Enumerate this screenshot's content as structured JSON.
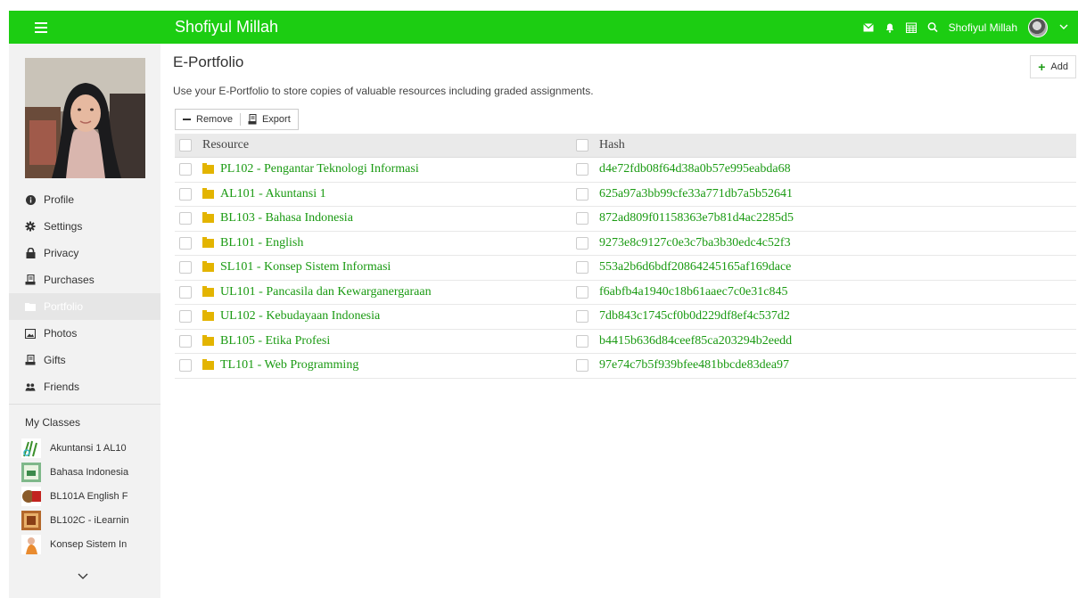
{
  "topbar": {
    "title": "Shofiyul Millah",
    "user_name": "Shofiyul Millah"
  },
  "sidebar": {
    "nav": [
      {
        "label": "Profile",
        "icon": "info-circle-icon"
      },
      {
        "label": "Settings",
        "icon": "gear-icon"
      },
      {
        "label": "Privacy",
        "icon": "lock-icon"
      },
      {
        "label": "Purchases",
        "icon": "receipt-icon"
      },
      {
        "label": "Portfolio",
        "icon": "folder-icon",
        "active": true
      },
      {
        "label": "Photos",
        "icon": "image-icon"
      },
      {
        "label": "Gifts",
        "icon": "gift-icon"
      },
      {
        "label": "Friends",
        "icon": "users-icon"
      }
    ],
    "classes_title": "My Classes",
    "classes": [
      "Akuntansi 1 AL10",
      "Bahasa Indonesia",
      "BL101A English F",
      "BL102C - iLearnin",
      "Konsep Sistem In"
    ]
  },
  "main": {
    "title": "E-Portfolio",
    "add_label": "Add",
    "description": "Use your E-Portfolio to store copies of valuable resources including graded assignments.",
    "remove_label": "Remove",
    "export_label": "Export",
    "columns": {
      "resource": "Resource",
      "hash": "Hash"
    },
    "rows": [
      {
        "resource": "PL102 - Pengantar Teknologi Informasi",
        "hash": "d4e72fdb08f64d38a0b57e995eabda68"
      },
      {
        "resource": "AL101 - Akuntansi 1",
        "hash": "625a97a3bb99cfe33a771db7a5b52641"
      },
      {
        "resource": "BL103 - Bahasa Indonesia",
        "hash": "872ad809f01158363e7b81d4ac2285d5"
      },
      {
        "resource": "BL101 - English",
        "hash": "9273e8c9127c0e3c7ba3b30edc4c52f3"
      },
      {
        "resource": "SL101 - Konsep Sistem Informasi",
        "hash": "553a2b6d6bdf20864245165af169dace"
      },
      {
        "resource": "UL101 - Pancasila dan Kewarganergaraan",
        "hash": "f6abfb4a1940c18b61aaec7c0e31c845"
      },
      {
        "resource": "UL102 - Kebudayaan Indonesia",
        "hash": "7db843c1745cf0b0d229df8ef4c537d2"
      },
      {
        "resource": "BL105 - Etika Profesi",
        "hash": "b4415b636d84ceef85ca203294b2eedd"
      },
      {
        "resource": "TL101 - Web Programming",
        "hash": "97e74c7b5f939bfee481bbcde83dea97"
      }
    ]
  },
  "colors": {
    "brand": "#1ccd12",
    "link": "#1a9a12",
    "folder": "#e3b400"
  }
}
